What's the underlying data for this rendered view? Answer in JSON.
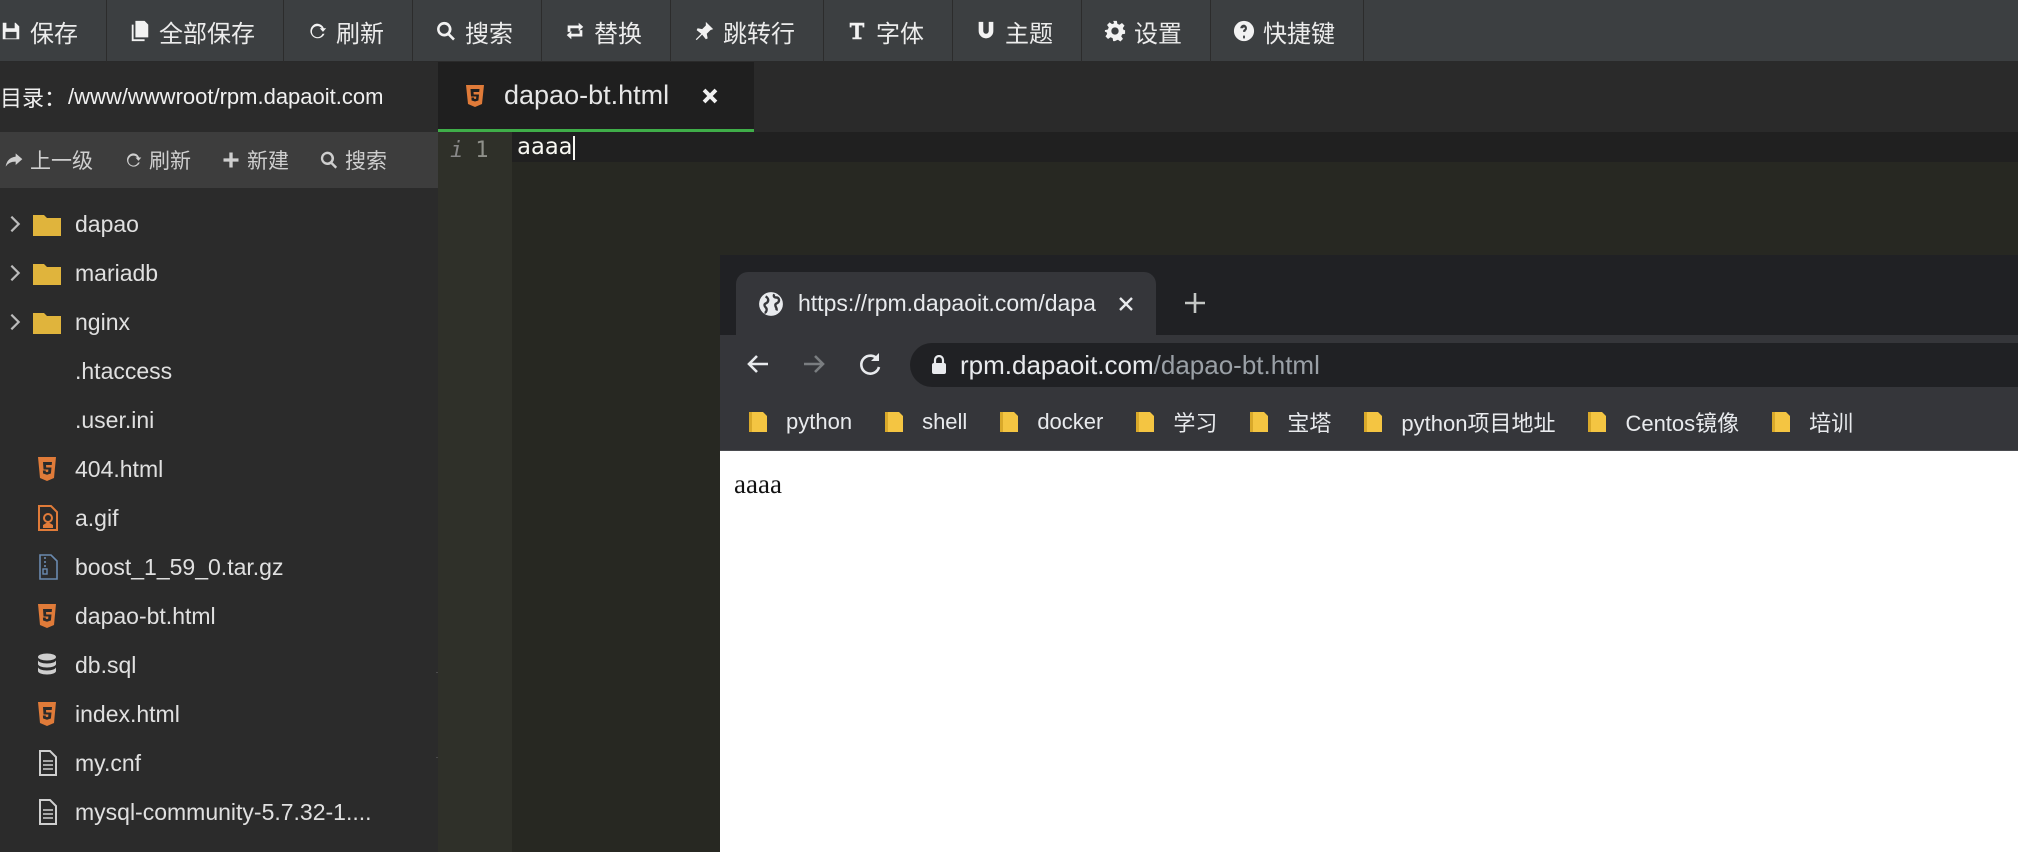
{
  "toolbar": {
    "items": [
      {
        "label": "保存",
        "icon": "save-icon"
      },
      {
        "label": "全部保存",
        "icon": "save-all-icon"
      },
      {
        "label": "刷新",
        "icon": "refresh-icon"
      },
      {
        "label": "搜索",
        "icon": "search-icon"
      },
      {
        "label": "替换",
        "icon": "replace-icon"
      },
      {
        "label": "跳转行",
        "icon": "pin-icon"
      },
      {
        "label": "字体",
        "icon": "font-icon"
      },
      {
        "label": "主题",
        "icon": "magnet-icon"
      },
      {
        "label": "设置",
        "icon": "gear-icon"
      },
      {
        "label": "快捷键",
        "icon": "help-icon"
      }
    ]
  },
  "file_panel": {
    "dir_label": "目录：",
    "dir_path": "/www/wwwroot/rpm.dapaoit.com",
    "actions": [
      {
        "label": "上一级",
        "icon": "share-icon"
      },
      {
        "label": "刷新",
        "icon": "refresh-icon"
      },
      {
        "label": "新建",
        "icon": "plus-icon"
      },
      {
        "label": "搜索",
        "icon": "search-icon"
      }
    ],
    "files": [
      {
        "name": "dapao",
        "type": "folder"
      },
      {
        "name": "mariadb",
        "type": "folder"
      },
      {
        "name": "nginx",
        "type": "folder"
      },
      {
        "name": ".htaccess",
        "type": "none"
      },
      {
        "name": ".user.ini",
        "type": "none"
      },
      {
        "name": "404.html",
        "type": "html"
      },
      {
        "name": "a.gif",
        "type": "image"
      },
      {
        "name": "boost_1_59_0.tar.gz",
        "type": "archive"
      },
      {
        "name": "dapao-bt.html",
        "type": "html"
      },
      {
        "name": "db.sql",
        "type": "database"
      },
      {
        "name": "index.html",
        "type": "html"
      },
      {
        "name": "my.cnf",
        "type": "text"
      },
      {
        "name": "mysql-community-5.7.32-1....",
        "type": "text"
      }
    ]
  },
  "editor": {
    "tab_title": "dapao-bt.html",
    "line_number": "1",
    "code_line": "aaaa"
  },
  "browser": {
    "tab_title": "https://rpm.dapaoit.com/dapa",
    "url_host": "rpm.dapaoit.com",
    "url_path": "/dapao-bt.html",
    "bookmarks": [
      "python",
      "shell",
      "docker",
      "学习",
      "宝塔",
      "python项目地址",
      "Centos镜像",
      "培训"
    ],
    "page_text": "aaaa"
  },
  "colors": {
    "toolbar_bg": "#3c3f41",
    "panel_bg": "#2b2b2b",
    "editor_bg": "#272822",
    "tab_active_underline": "#3fae49",
    "folder": "#e0b43c",
    "html_icon": "#e07b39",
    "chrome_dark": "#35363a"
  }
}
